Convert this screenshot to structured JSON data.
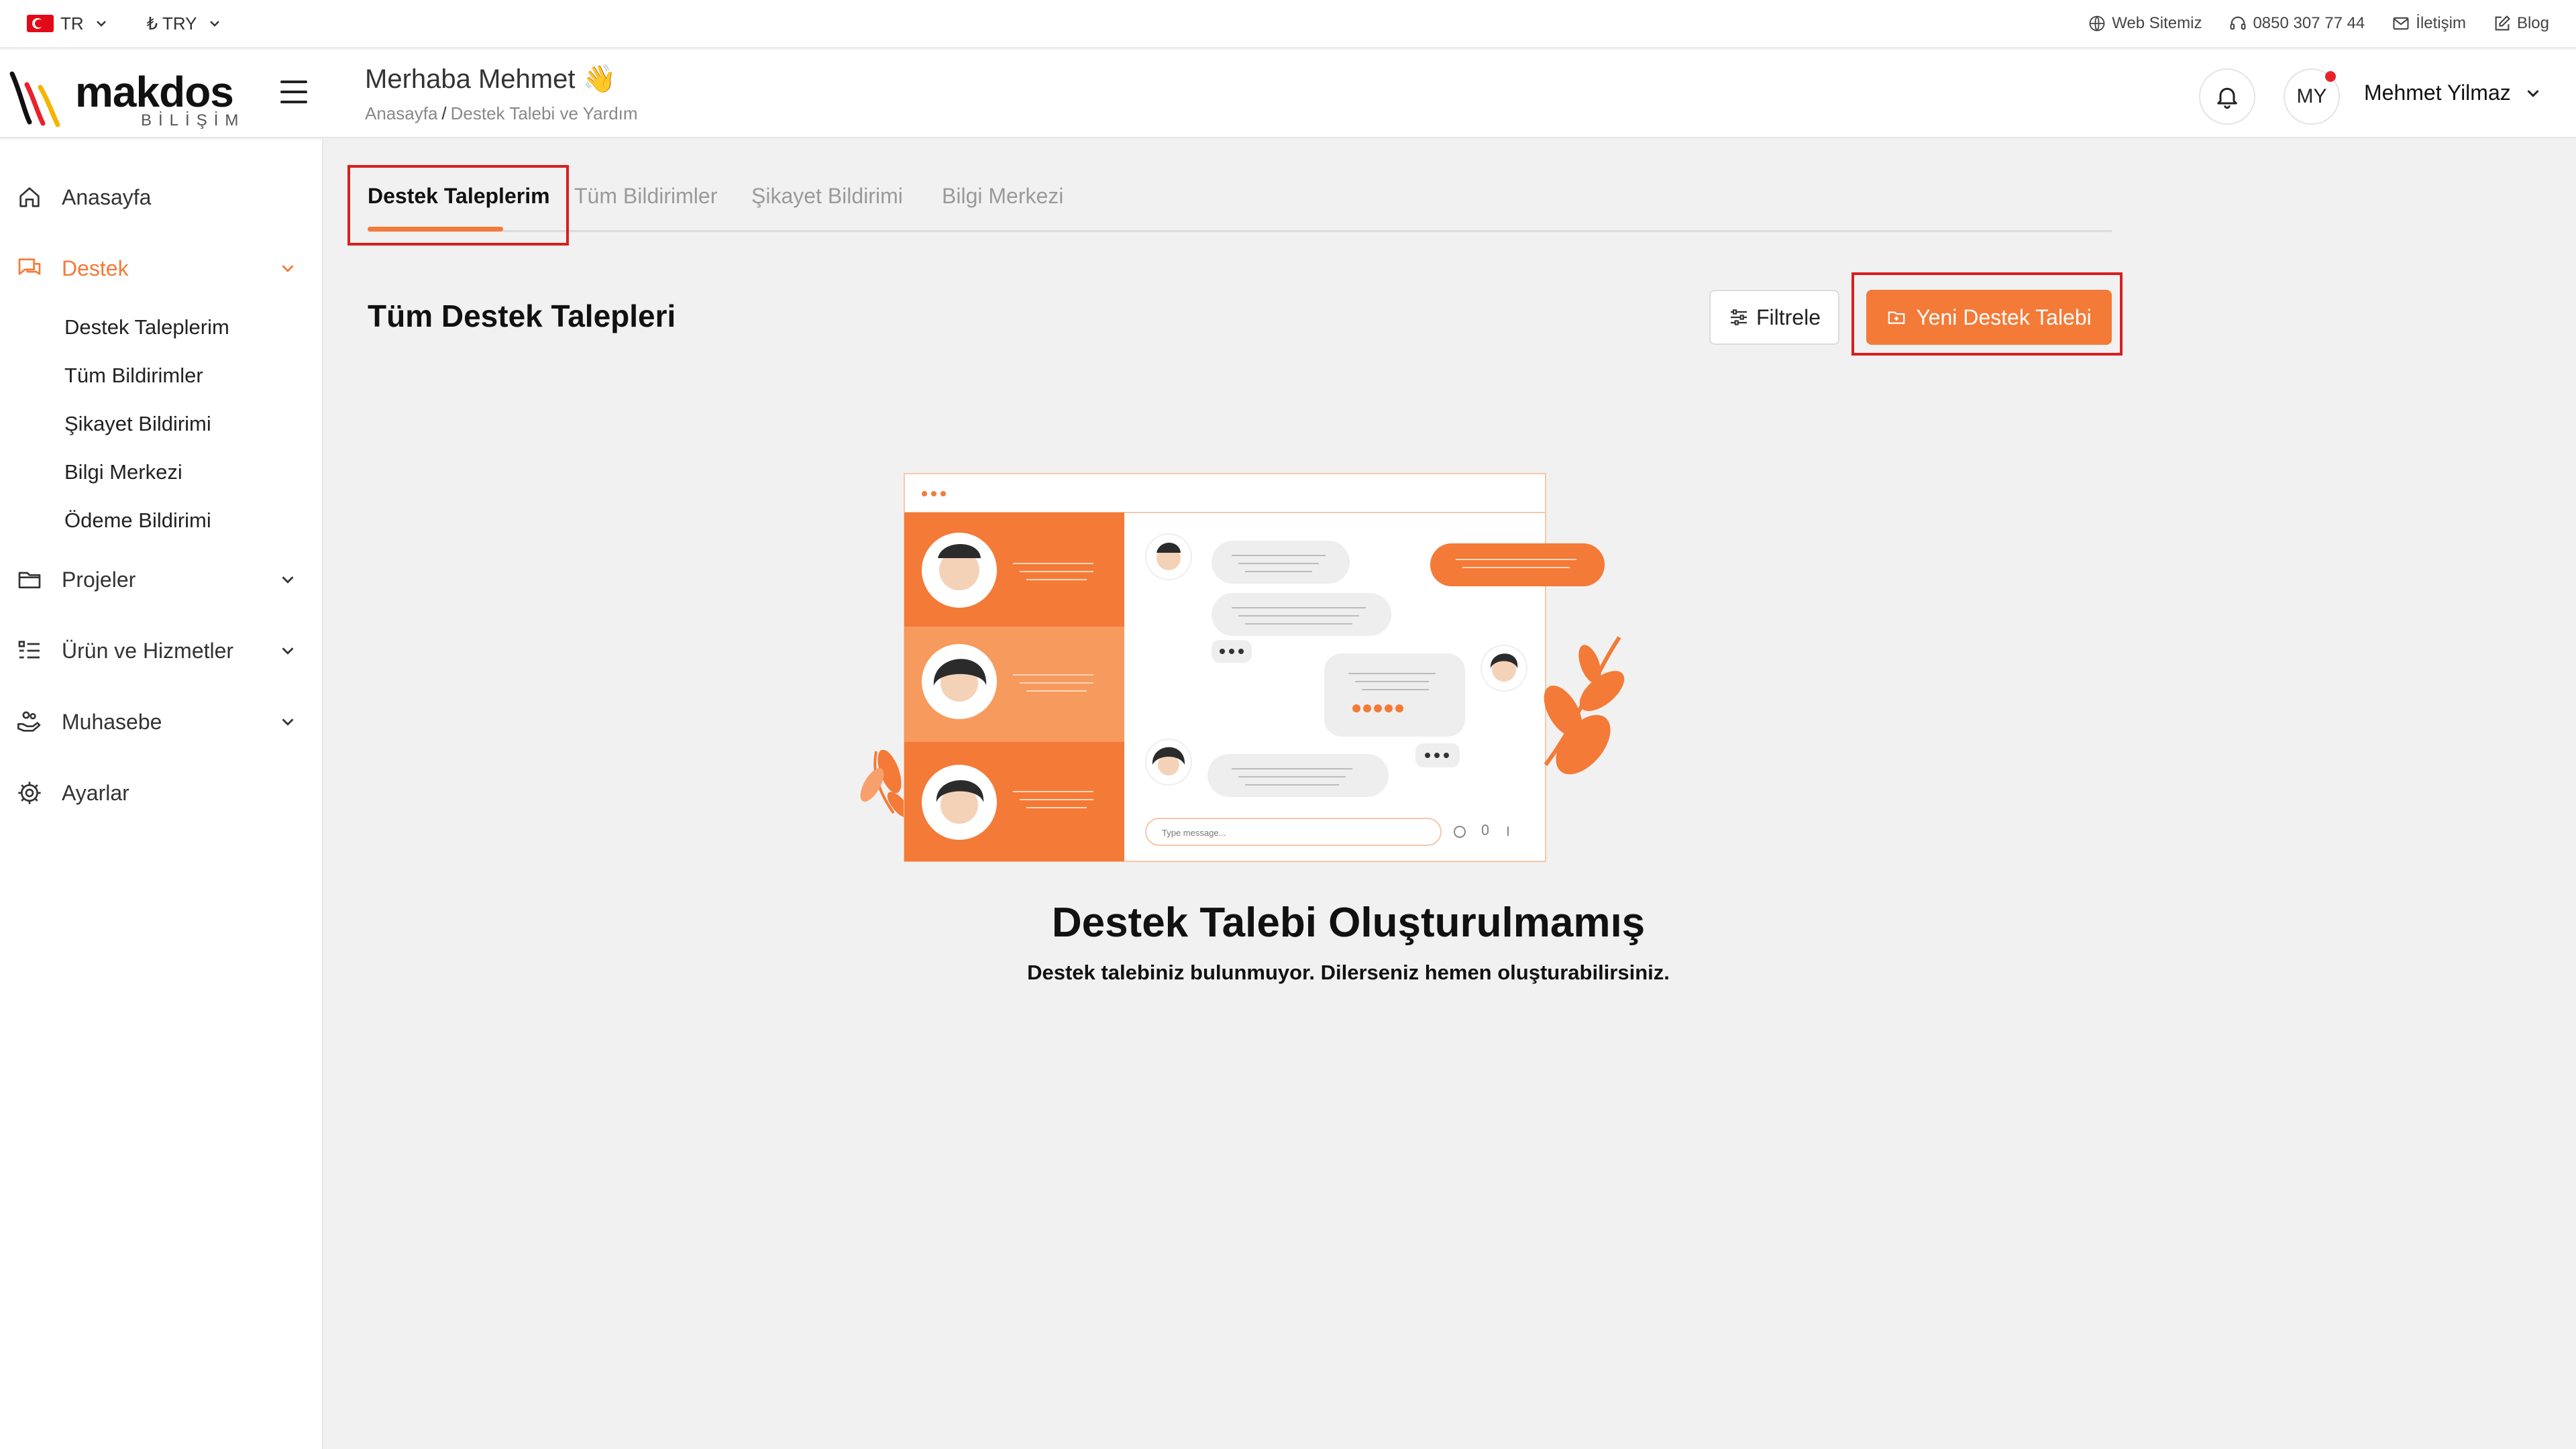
{
  "topbar": {
    "language": "TR",
    "currency": "₺ TRY",
    "links": [
      {
        "label": "Web Sitemiz",
        "icon": "globe-icon"
      },
      {
        "label": "0850 307 77 44",
        "icon": "headset-icon"
      },
      {
        "label": "İletişim",
        "icon": "mail-icon"
      },
      {
        "label": "Blog",
        "icon": "edit-icon"
      }
    ]
  },
  "brand": {
    "name": "makdos",
    "tagline": "BİLİŞİM",
    "accent": "#f47a37"
  },
  "header": {
    "greeting": "Merhaba Mehmet 👋",
    "breadcrumb_home": "Anasayfa",
    "breadcrumb_sep": "/",
    "breadcrumb_current": "Destek Talebi ve Yardım",
    "avatar_initials": "MY",
    "user_name": "Mehmet Yilmaz"
  },
  "sidebar": {
    "items": [
      {
        "label": "Anasayfa"
      },
      {
        "label": "Destek"
      },
      {
        "label": "Projeler"
      },
      {
        "label": "Ürün ve Hizmetler"
      },
      {
        "label": "Muhasebe"
      },
      {
        "label": "Ayarlar"
      }
    ],
    "destek_sub": [
      {
        "label": "Destek Taleplerim"
      },
      {
        "label": "Tüm Bildirimler"
      },
      {
        "label": "Şikayet Bildirimi"
      },
      {
        "label": "Bilgi Merkezi"
      },
      {
        "label": "Ödeme Bildirimi"
      }
    ]
  },
  "tabs": [
    {
      "label": "Destek Taleplerim",
      "active": true
    },
    {
      "label": "Tüm Bildirimler"
    },
    {
      "label": "Şikayet Bildirimi"
    },
    {
      "label": "Bilgi Merkezi"
    }
  ],
  "main": {
    "section_title": "Tüm Destek Talepleri",
    "filter_label": "Filtrele",
    "new_ticket_label": "Yeni Destek Talebi",
    "illustration_input_placeholder": "Type message...",
    "empty_title": "Destek Talebi Oluşturulmamış",
    "empty_desc": "Destek talebiniz bulunmuyor. Dilerseniz hemen oluşturabilirsiniz."
  }
}
